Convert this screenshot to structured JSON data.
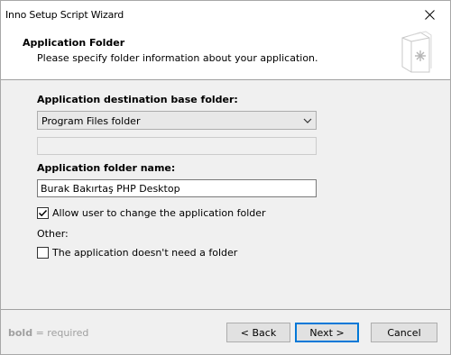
{
  "window": {
    "title": "Inno Setup Script Wizard"
  },
  "header": {
    "title": "Application Folder",
    "subtitle": "Please specify folder information about your application."
  },
  "form": {
    "base_folder_label": "Application destination base folder:",
    "base_folder_value": "Program Files folder",
    "custom_base_value": "",
    "folder_name_label": "Application folder name:",
    "folder_name_value": "Burak Bakırtaş PHP Desktop",
    "allow_change_label": "Allow user to change the application folder",
    "allow_change_checked": true,
    "other_label": "Other:",
    "no_folder_label": "The application doesn't need a folder",
    "no_folder_checked": false
  },
  "footer": {
    "legend_bold": "bold",
    "legend_rest": " = required",
    "back_label": "< Back",
    "next_label": "Next >",
    "cancel_label": "Cancel"
  },
  "colors": {
    "accent": "#0078d7",
    "dialog_bg": "#f0f0f0",
    "legend_text": "#a0a0a0"
  },
  "icons": [
    "close-icon",
    "wizard-document-icon",
    "dropdown-chevron-icon",
    "checkmark-icon"
  ]
}
